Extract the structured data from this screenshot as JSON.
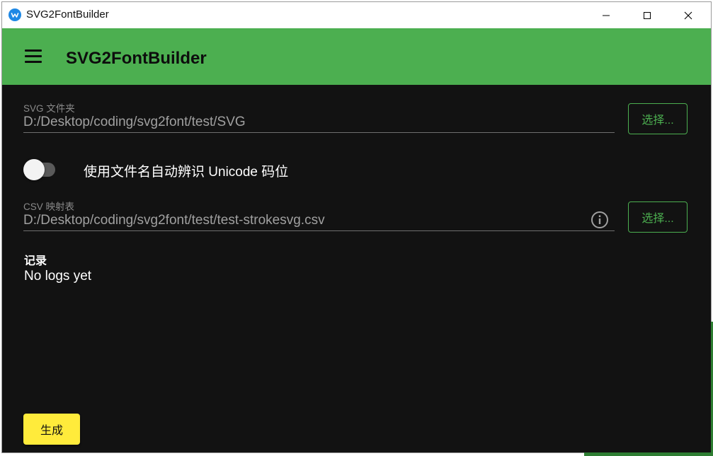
{
  "window": {
    "title": "SVG2FontBuilder",
    "icons": {
      "app": "app-logo-icon",
      "minimize": "minimize-icon",
      "maximize": "maximize-icon",
      "close": "close-icon"
    }
  },
  "appbar": {
    "title": "SVG2FontBuilder",
    "menu_icon": "hamburger-menu-icon",
    "color": "#4caf50"
  },
  "svg_folder": {
    "label": "SVG 文件夹",
    "value": "D:/Desktop/coding/svg2font/test/SVG",
    "button_label": "选择..."
  },
  "toggle": {
    "label": "使用文件名自动辨识 Unicode 码位",
    "checked": false
  },
  "csv_map": {
    "label": "CSV 映射表",
    "value": "D:/Desktop/coding/svg2font/test/test-strokesvg.csv",
    "button_label": "选择...",
    "info_icon": "info-icon"
  },
  "log": {
    "heading": "记录",
    "text": "No logs yet"
  },
  "generate": {
    "label": "生成",
    "color": "#ffeb3b"
  },
  "theme": {
    "background": "#121212",
    "accent": "#4caf50"
  }
}
